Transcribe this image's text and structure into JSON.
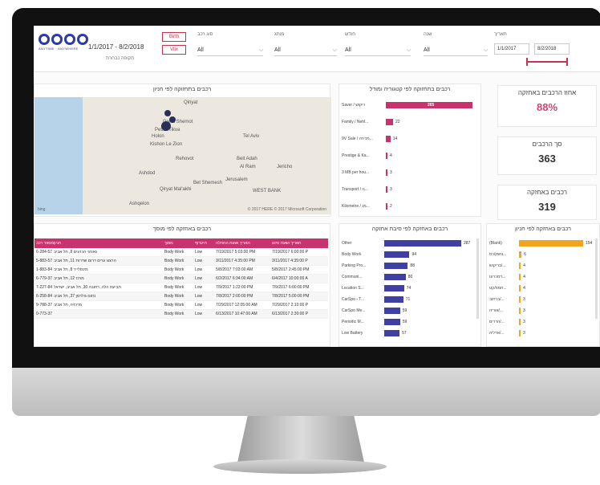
{
  "header": {
    "brand_tag": "ANYTIME · ANYWHERE",
    "date_range": "1/1/2017 - 8/2/2018",
    "date_caption": "תקופה נבחרת",
    "toggle_top": "Birth",
    "toggle_bottom": "Vtix",
    "filters": [
      {
        "label": "סוג רכב",
        "value": "All"
      },
      {
        "label": "מותג",
        "value": "All"
      },
      {
        "label": "חודש",
        "value": "All"
      },
      {
        "label": "שנה",
        "value": "All"
      }
    ],
    "date_filter": {
      "label": "תאריך",
      "start": "1/1/2017",
      "end": "8/2/2018"
    }
  },
  "map_panel": {
    "title": "רכבים בתחזוקה לפי חניון",
    "labels": [
      "Qiriyat",
      "Great Shemot",
      "Petah Tikva",
      "Holon",
      "Kishon Le Zion",
      "Tel Aviv",
      "Rehovot",
      "Beit Adah",
      "Al Ram",
      "Jericho",
      "Ashdod",
      "Qiryat Mal'akhi",
      "Bet Shemesh",
      "Jerusalem",
      "WEST BANK",
      "Ashqelon"
    ],
    "bing": "bing",
    "copyright": "© 2017 HERE  © 2017 Microsoft Corporation"
  },
  "type_panel": {
    "title": "רכבים בתחזוקה לפי קטגוריה ומודל",
    "rows": [
      {
        "label": "Saver / ריקוש",
        "value": 265
      },
      {
        "label": "Family / Nehl...",
        "value": 22
      },
      {
        "label": "9V Sale / מכירה...",
        "value": 14
      },
      {
        "label": "Prestige & Ka...",
        "value": 4
      },
      {
        "label": "3 MB per hou...",
        "value": 3
      },
      {
        "label": "Transport / נו...",
        "value": 3
      },
      {
        "label": "Kilometre / מנ...",
        "value": 2
      }
    ]
  },
  "kpis": [
    {
      "title": "אחוז הרכבים באחזקה",
      "value": "88%"
    },
    {
      "title": "סך הרכבים",
      "value": "363"
    },
    {
      "title": "רכבים באחזקה",
      "value": "319"
    }
  ],
  "table_panel": {
    "title": "רכבים באחזקה לפי מוסך",
    "columns": [
      "מספר רכב",
      "חניון",
      "מוסך",
      "תיעדוף",
      "תאריך ושעת התחלה",
      "תאריך ושעת סיום"
    ],
    "rows": [
      [
        "6-284-57",
        "גאורגי הכהנים 8, תל אביב",
        "Body Work",
        "Low",
        "7/19/2017 5:03:00 PM",
        "7/19/2017 6:00:00 P"
      ],
      [
        "5-883-57",
        "הרצוג ערים דרום שדרות 11, תל אביב",
        "Body Work",
        "Low",
        "3/11/2017 4:35:00 PM",
        "3/11/2017 4:35:00 P"
      ],
      [
        "1-883-84",
        "מינסלייר 8, תל אביב",
        "Body Work",
        "Low",
        "5/8/2017 7:03:00 AM",
        "5/8/2017 2:45:00 PM"
      ],
      [
        "6-779-37",
        "מרכז 12, תל אביב",
        "Body Work",
        "Low",
        "6/2/2017 6:34:00 AM",
        "6/4/2017 10:00:00 A"
      ],
      [
        "7-227-84",
        "תביעת הלה, רחובה 30, תל אביב, ישראל",
        "Body Work",
        "Low",
        "7/9/2017 1:22:00 PM",
        "7/9/2017 6:00:00 PM"
      ],
      [
        "6-258-84",
        "נחום גולדמן 37, תל אביב",
        "Body Work",
        "Low",
        "7/8/2017 2:00:00 PM",
        "7/8/2017 5:00:00 PM"
      ],
      [
        "9-788-37",
        "מרכזיה, תל אביב",
        "Body Work",
        "Low",
        "7/29/2017 12:05:00 AM",
        "7/29/2017 2:10:00 P"
      ],
      [
        "0-773-37",
        "",
        "Body Work",
        "Low",
        "6/13/2017 10:47:00 AM",
        "6/13/2017 2:30:00 P"
      ]
    ]
  },
  "reason_panel": {
    "title": "רכבים באחזקה לפי סיבת אחזקה",
    "rows": [
      {
        "label": "Other",
        "value": 287
      },
      {
        "label": "Body Work",
        "value": 94
      },
      {
        "label": "Parking Pro...",
        "value": 88
      },
      {
        "label": "Communi...",
        "value": 80
      },
      {
        "label": "Location S...",
        "value": 74
      },
      {
        "label": "CarSpo - T...",
        "value": 71
      },
      {
        "label": "CarSpo Me...",
        "value": 59
      },
      {
        "label": "Periodic M...",
        "value": 59
      },
      {
        "label": "Low Battery",
        "value": 57
      }
    ]
  },
  "lot_panel": {
    "title": "רכבים באחזקה לפי חניון",
    "rows": [
      {
        "label": "(Blank)",
        "value": 154
      },
      {
        "label": "נחמן/כס...",
        "value": 6
      },
      {
        "label": "בריקוש/...",
        "value": 4
      },
      {
        "label": "דמכרונו...",
        "value": 4
      },
      {
        "label": "חמפ/קט...",
        "value": 4
      },
      {
        "label": "ברחוב/...",
        "value": 3
      },
      {
        "label": "אוריה/...",
        "value": 3
      },
      {
        "label": "הדרים/...",
        "value": 3
      },
      {
        "label": "אדליה/...",
        "value": 3
      }
    ]
  },
  "colors": {
    "accent": "#c8336e",
    "reason_bar": "#3f3fa6",
    "lot_bar": "#f2a51c"
  }
}
